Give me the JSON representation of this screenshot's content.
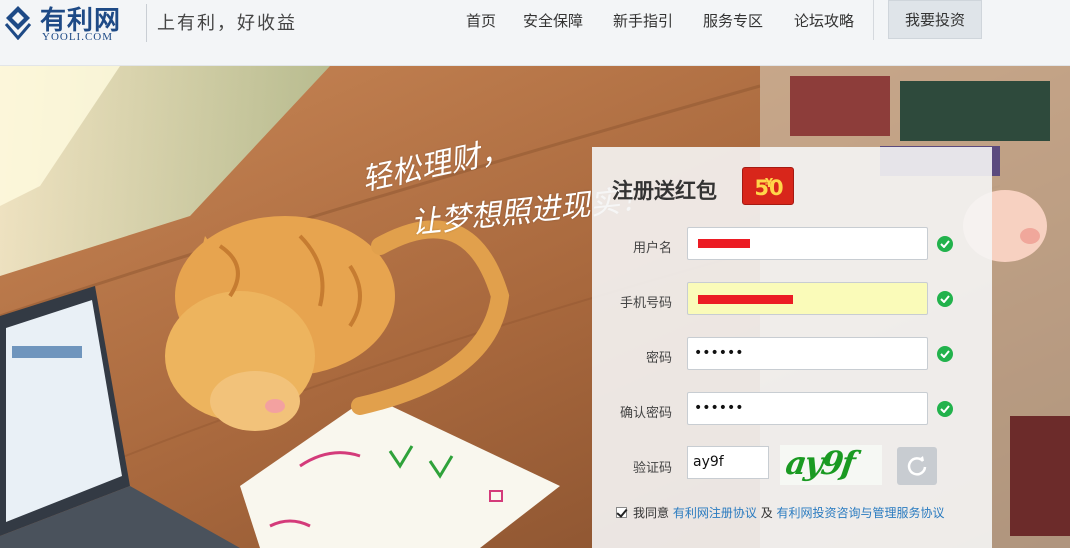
{
  "brand": {
    "name_cn": "有利网",
    "name_en": "YOOLI.COM",
    "slogan": "上有利，好收益"
  },
  "nav": {
    "items": [
      "首页",
      "安全保障",
      "新手指引",
      "服务专区",
      "论坛攻略"
    ],
    "invest_button": "我要投资"
  },
  "hero": {
    "tagline_line1": "轻松理财，",
    "tagline_line2": "让梦想照进现实！"
  },
  "register": {
    "title": "注册送红包",
    "bonus_amount": "50",
    "bonus_currency": "¥",
    "fields": {
      "username": {
        "label": "用户名",
        "value": "",
        "valid": true
      },
      "phone": {
        "label": "手机号码",
        "value": "",
        "valid": true
      },
      "password": {
        "label": "密码",
        "value": "••••••",
        "valid": true
      },
      "confirm_password": {
        "label": "确认密码",
        "value": "••••••",
        "valid": true
      },
      "captcha": {
        "label": "验证码",
        "value": "ay9f"
      }
    },
    "captcha_image_text": "ay9f",
    "agreement": {
      "checked": true,
      "prefix": "我同意",
      "link1": "有利网注册协议",
      "joiner": "及",
      "link2": "有利网投资咨询与管理服务协议"
    }
  },
  "colors": {
    "brand_blue": "#1e4a86",
    "valid_green": "#22b24c",
    "redaction_red": "#ec1c24",
    "link_blue": "#2a7bc0",
    "envelope_red": "#d8261b"
  }
}
